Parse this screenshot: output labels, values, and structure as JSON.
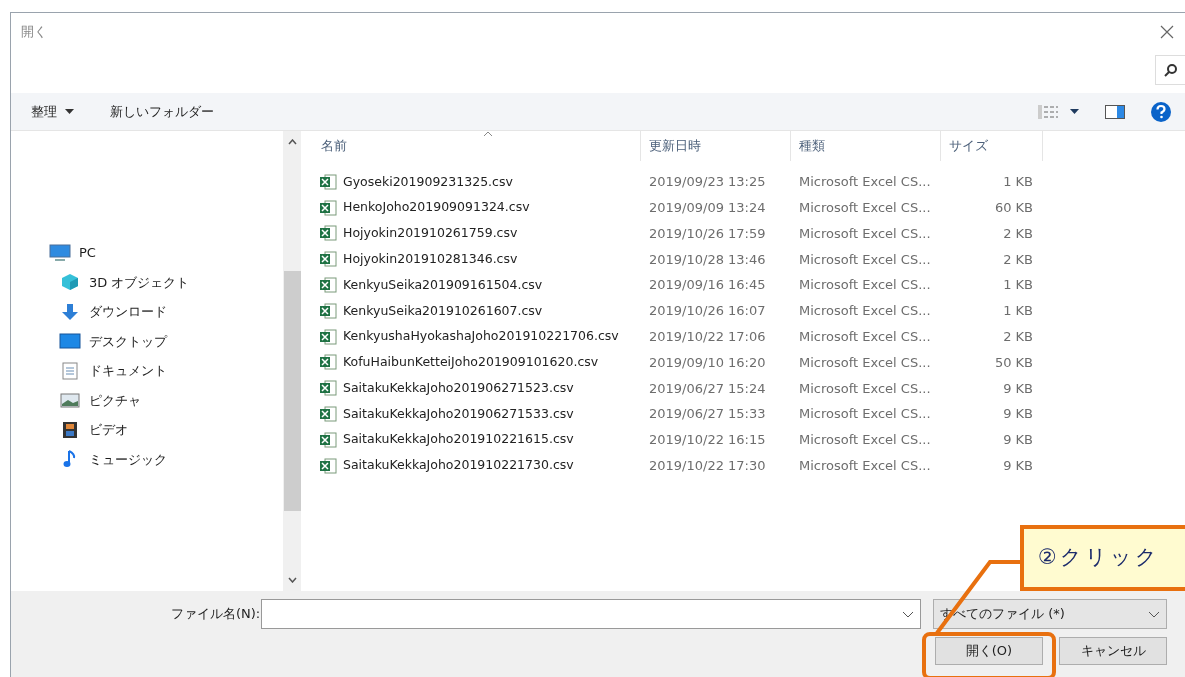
{
  "window": {
    "title": "開く"
  },
  "toolbar": {
    "organize": "整理",
    "new_folder": "新しいフォルダー"
  },
  "sidebar": {
    "items": [
      {
        "label": "PC",
        "kind": "pc",
        "children": [
          {
            "label": "3D オブジェクト",
            "kind": "cube"
          },
          {
            "label": "ダウンロード",
            "kind": "download"
          },
          {
            "label": "デスクトップ",
            "kind": "desktop"
          },
          {
            "label": "ドキュメント",
            "kind": "document"
          },
          {
            "label": "ピクチャ",
            "kind": "picture"
          },
          {
            "label": "ビデオ",
            "kind": "video"
          },
          {
            "label": "ミュージック",
            "kind": "music"
          }
        ]
      }
    ]
  },
  "table": {
    "columns": [
      "名前",
      "更新日時",
      "種類",
      "サイズ"
    ],
    "rows": [
      [
        "Gyoseki201909231325.csv",
        "2019/09/23 13:25",
        "Microsoft Excel CS...",
        "1 KB"
      ],
      [
        "HenkoJoho201909091324.csv",
        "2019/09/09 13:24",
        "Microsoft Excel CS...",
        "60 KB"
      ],
      [
        "Hojyokin201910261759.csv",
        "2019/10/26 17:59",
        "Microsoft Excel CS...",
        "2 KB"
      ],
      [
        "Hojyokin201910281346.csv",
        "2019/10/28 13:46",
        "Microsoft Excel CS...",
        "2 KB"
      ],
      [
        "KenkyuSeika201909161504.csv",
        "2019/09/16 16:45",
        "Microsoft Excel CS...",
        "1 KB"
      ],
      [
        "KenkyuSeika201910261607.csv",
        "2019/10/26 16:07",
        "Microsoft Excel CS...",
        "1 KB"
      ],
      [
        "KenkyushaHyokashaJoho201910221706.csv",
        "2019/10/22 17:06",
        "Microsoft Excel CS...",
        "2 KB"
      ],
      [
        "KofuHaibunKetteiJoho201909101620.csv",
        "2019/09/10 16:20",
        "Microsoft Excel CS...",
        "50 KB"
      ],
      [
        "SaitakuKekkaJoho201906271523.csv",
        "2019/06/27 15:24",
        "Microsoft Excel CS...",
        "9 KB"
      ],
      [
        "SaitakuKekkaJoho201906271533.csv",
        "2019/06/27 15:33",
        "Microsoft Excel CS...",
        "9 KB"
      ],
      [
        "SaitakuKekkaJoho201910221615.csv",
        "2019/10/22 16:15",
        "Microsoft Excel CS...",
        "9 KB"
      ],
      [
        "SaitakuKekkaJoho201910221730.csv",
        "2019/10/22 17:30",
        "Microsoft Excel CS...",
        "9 KB"
      ]
    ]
  },
  "footer": {
    "filename_label": "ファイル名(N):",
    "filter": "すべてのファイル (*)",
    "open_button": "開く(O)",
    "cancel_button": "キャンセル"
  },
  "callout": {
    "text": "②クリック"
  }
}
